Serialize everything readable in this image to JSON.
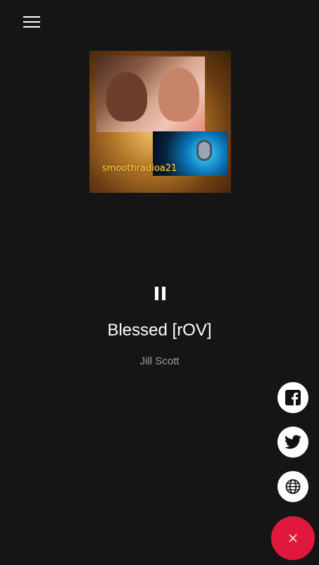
{
  "menu": {
    "icon": "hamburger-menu-icon"
  },
  "album": {
    "caption": "smoothradioa21"
  },
  "player": {
    "state_icon": "pause-icon",
    "title": "Blessed [rOV]",
    "artist": "Jill Scott"
  },
  "social": [
    {
      "icon": "facebook-icon"
    },
    {
      "icon": "twitter-icon"
    },
    {
      "icon": "globe-icon"
    }
  ],
  "fab": {
    "icon": "close-icon",
    "color": "#e0183e"
  }
}
